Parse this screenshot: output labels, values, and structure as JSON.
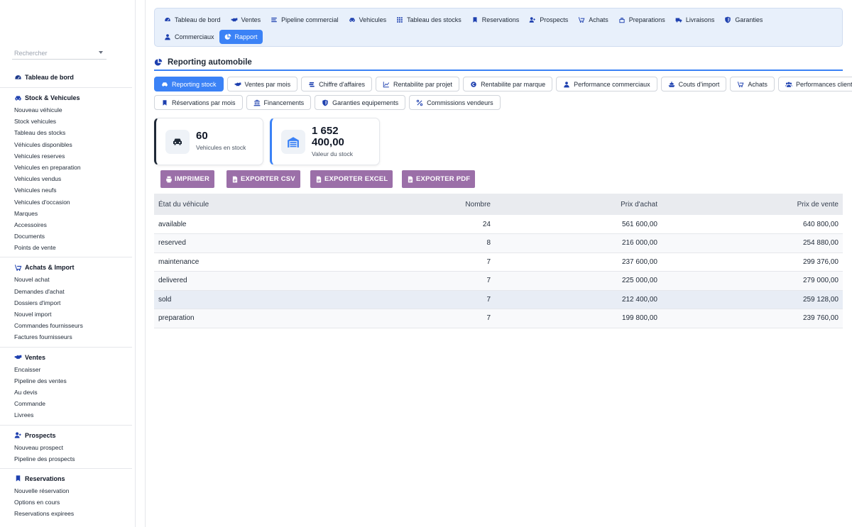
{
  "sidebar": {
    "search_placeholder": "Rechercher",
    "dashboard": "Tableau de bord",
    "sections": [
      {
        "title": "Stock & Vehicules",
        "icon": "car-icon",
        "items": [
          "Nouveau véhicule",
          "Stock vehicules",
          "Tableau des stocks",
          "Véhicules disponibles",
          "Vehicules reserves",
          "Vehicules en preparation",
          "Vehicules vendus",
          "Vehicules neufs",
          "Vehicules d'occasion",
          "Marques",
          "Accessoires",
          "Documents",
          "Points de vente"
        ]
      },
      {
        "title": "Achats & Import",
        "icon": "cart-icon",
        "items": [
          "Nouvel achat",
          "Demandes d'achat",
          "Dossiers d'import",
          "Nouvel import",
          "Commandes fournisseurs",
          "Factures fournisseurs"
        ]
      },
      {
        "title": "Ventes",
        "icon": "handshake-icon",
        "items": [
          "Encaisser",
          "Pipeline des ventes",
          "Au devis",
          "Commande",
          "Livrees"
        ]
      },
      {
        "title": "Prospects",
        "icon": "user-plus-icon",
        "items": [
          "Nouveau prospect",
          "Pipeline des prospects"
        ]
      },
      {
        "title": "Reservations",
        "icon": "bookmark-icon",
        "items": [
          "Nouvelle réservation",
          "Options en cours",
          "Reservations expirees"
        ]
      }
    ]
  },
  "topnav": {
    "row1": [
      {
        "label": "Tableau de bord",
        "icon": "dashboard-icon"
      },
      {
        "label": "Ventes",
        "icon": "handshake-icon"
      },
      {
        "label": "Pipeline commercial",
        "icon": "list-icon"
      },
      {
        "label": "Vehicules",
        "icon": "car-icon"
      },
      {
        "label": "Tableau des stocks",
        "icon": "grid-icon"
      },
      {
        "label": "Reservations",
        "icon": "bookmark-icon"
      },
      {
        "label": "Prospects",
        "icon": "user-plus-icon"
      },
      {
        "label": "Achats",
        "icon": "cart-icon"
      },
      {
        "label": "Preparations",
        "icon": "tools-icon"
      },
      {
        "label": "Livraisons",
        "icon": "truck-icon"
      },
      {
        "label": "Garanties",
        "icon": "shield-icon"
      }
    ],
    "row2": [
      {
        "label": "Commerciaux",
        "icon": "user-icon"
      },
      {
        "label": "Rapport",
        "icon": "pie-icon",
        "active": true
      }
    ]
  },
  "page_title": "Reporting automobile",
  "tabs": {
    "row1": [
      {
        "label": "Reporting stock",
        "icon": "car-icon",
        "active": true
      },
      {
        "label": "Ventes par mois",
        "icon": "handshake-icon"
      },
      {
        "label": "Chiffre d'affaires",
        "icon": "coins-icon"
      },
      {
        "label": "Rentabilite par projet",
        "icon": "chart-line-icon"
      },
      {
        "label": "Rentabilite par marque",
        "icon": "copyright-icon"
      },
      {
        "label": "Performance commerciaux",
        "icon": "user-icon"
      },
      {
        "label": "Couts d'import",
        "icon": "ship-icon"
      },
      {
        "label": "Achats",
        "icon": "cart-icon"
      },
      {
        "label": "Performances clients",
        "icon": "users-icon"
      }
    ],
    "row2": [
      {
        "label": "Réservations par mois",
        "icon": "bookmark-icon"
      },
      {
        "label": "Financements",
        "icon": "bank-icon"
      },
      {
        "label": "Garanties equipements",
        "icon": "shield-icon"
      },
      {
        "label": "Commissions vendeurs",
        "icon": "percent-icon"
      }
    ]
  },
  "cards": [
    {
      "value": "60",
      "label": "Vehicules en stock",
      "icon": "car-icon"
    },
    {
      "value_line1": "1 652",
      "value_line2": "400,00",
      "label": "Valeur du stock",
      "icon": "warehouse-icon"
    }
  ],
  "export_buttons": [
    {
      "label": "IMPRIMER",
      "icon": "print-icon"
    },
    {
      "label": "EXPORTER CSV",
      "icon": "file-csv-icon"
    },
    {
      "label": "EXPORTER EXCEL",
      "icon": "file-excel-icon"
    },
    {
      "label": "EXPORTER PDF",
      "icon": "file-pdf-icon"
    }
  ],
  "table": {
    "headers": [
      "État du véhicule",
      "Nombre",
      "Prix d'achat",
      "Prix de vente"
    ],
    "rows": [
      [
        "available",
        "24",
        "561 600,00",
        "640 800,00"
      ],
      [
        "reserved",
        "8",
        "216 000,00",
        "254 880,00"
      ],
      [
        "maintenance",
        "7",
        "237 600,00",
        "299 376,00"
      ],
      [
        "delivered",
        "7",
        "225 000,00",
        "279 000,00"
      ],
      [
        "sold",
        "7",
        "212 400,00",
        "259 128,00"
      ],
      [
        "preparation",
        "7",
        "199 800,00",
        "239 760,00"
      ]
    ]
  },
  "colors": {
    "accent": "#3b82f6",
    "export": "#9b6fa8",
    "dark": "#1f2937"
  }
}
